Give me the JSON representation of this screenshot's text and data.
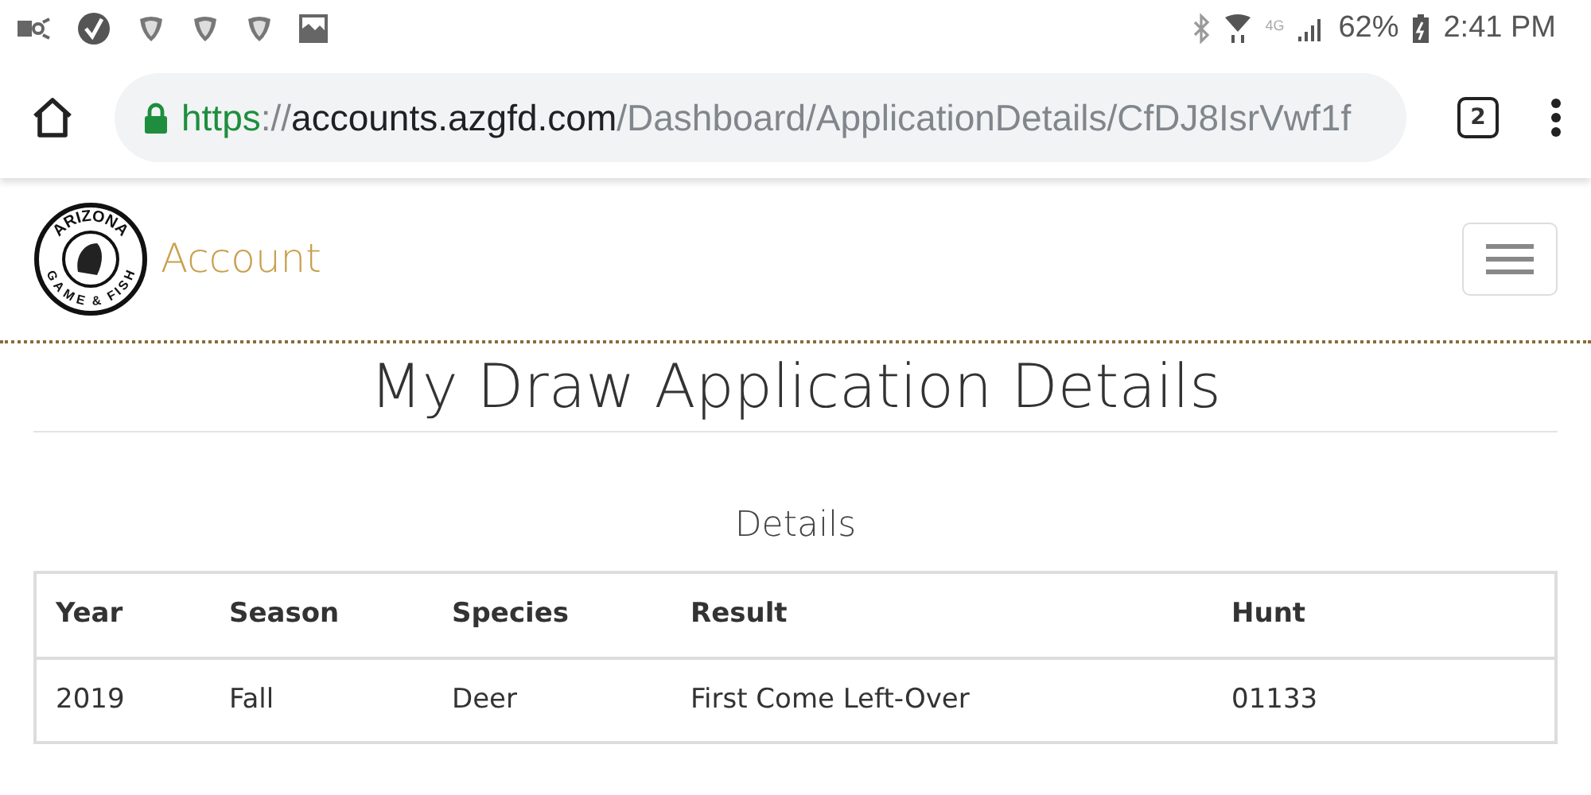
{
  "status_bar": {
    "network": "4G",
    "battery": "62%",
    "time": "2:41 PM"
  },
  "browser": {
    "url": {
      "scheme": "https",
      "separator": "://",
      "host": "accounts.azgfd.com",
      "path": "/Dashboard/ApplicationDetails/CfDJ8IsrVwf1f"
    },
    "tab_count": "2"
  },
  "site_header": {
    "logo_top": "ARIZONA",
    "logo_bottom": "GAME & FISH",
    "brand": "Account"
  },
  "page": {
    "title": "My Draw Application Details",
    "section_title": "Details"
  },
  "table": {
    "columns": [
      "Year",
      "Season",
      "Species",
      "Result",
      "Hunt"
    ],
    "rows": [
      [
        "2019",
        "Fall",
        "Deer",
        "First Come Left-Over",
        "01133"
      ]
    ]
  }
}
